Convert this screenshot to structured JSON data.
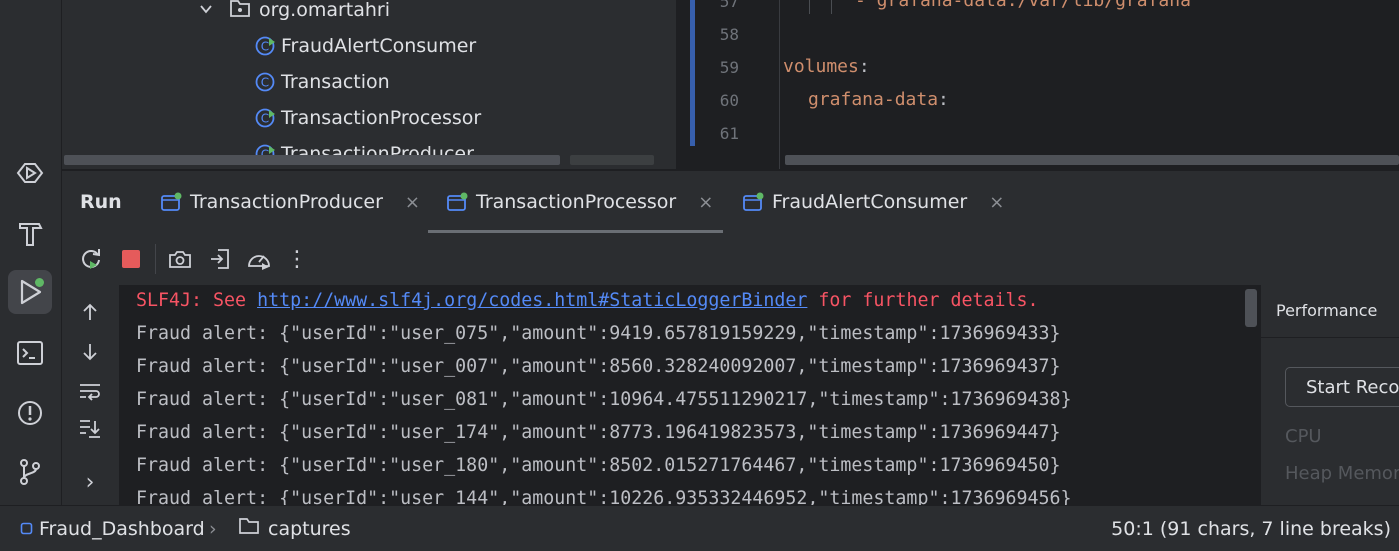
{
  "project_tree": {
    "package": "org.omartahri",
    "items": [
      {
        "label": "FraudAlertConsumer",
        "icon": "runnable-class-icon"
      },
      {
        "label": "Transaction",
        "icon": "class-icon"
      },
      {
        "label": "TransactionProcessor",
        "icon": "runnable-class-icon"
      },
      {
        "label": "TransactionProducer",
        "icon": "runnable-class-icon"
      }
    ]
  },
  "editor": {
    "lines": [
      {
        "num": "57",
        "text": "- grafana-data:/var/lib/grafana"
      },
      {
        "num": "58",
        "text": ""
      },
      {
        "num": "59",
        "key": "volumes",
        "colon": ":"
      },
      {
        "num": "60",
        "key": "grafana-data",
        "colon": ":"
      },
      {
        "num": "61",
        "text": ""
      }
    ]
  },
  "run": {
    "title": "Run",
    "tabs": [
      {
        "label": "TransactionProducer",
        "active": false
      },
      {
        "label": "TransactionProcessor",
        "active": true
      },
      {
        "label": "FraudAlertConsumer",
        "active": false
      }
    ],
    "close_glyph": "×",
    "more_glyph": "⋮",
    "expand_glyph": "›"
  },
  "console": {
    "slf4j": {
      "prefix": "SLF4J: See ",
      "link": "http://www.slf4j.org/codes.html#StaticLoggerBinder",
      "suffix": " for further details."
    },
    "lines": [
      "Fraud alert: {\"userId\":\"user_075\",\"amount\":9419.657819159229,\"timestamp\":1736969433}",
      "Fraud alert: {\"userId\":\"user_007\",\"amount\":8560.328240092007,\"timestamp\":1736969437}",
      "Fraud alert: {\"userId\":\"user_081\",\"amount\":10964.475511290217,\"timestamp\":1736969438}",
      "Fraud alert: {\"userId\":\"user_174\",\"amount\":8773.196419823573,\"timestamp\":1736969447}",
      "Fraud alert: {\"userId\":\"user_180\",\"amount\":8502.015271764467,\"timestamp\":1736969450}",
      "Fraud alert: {\"userId\":\"user_144\",\"amount\":10226.935332446952,\"timestamp\":1736969456}"
    ]
  },
  "performance": {
    "title": "Performance",
    "start_button": "Start Recording",
    "cpu_label": "CPU",
    "heap_label": "Heap Memory"
  },
  "status_bar": {
    "project": "Fraud_Dashboard",
    "separator": "›",
    "folder": "captures",
    "position": "50:1 (91 chars, 7 line breaks)"
  },
  "colors": {
    "background": "#1e1f22",
    "panel": "#2b2d30",
    "keyword": "#cf8e6d",
    "error": "#f75464",
    "link": "#548af7",
    "run_indicator": "#5fb865",
    "stop": "#e55b5b",
    "class_icon": "#548af7"
  }
}
